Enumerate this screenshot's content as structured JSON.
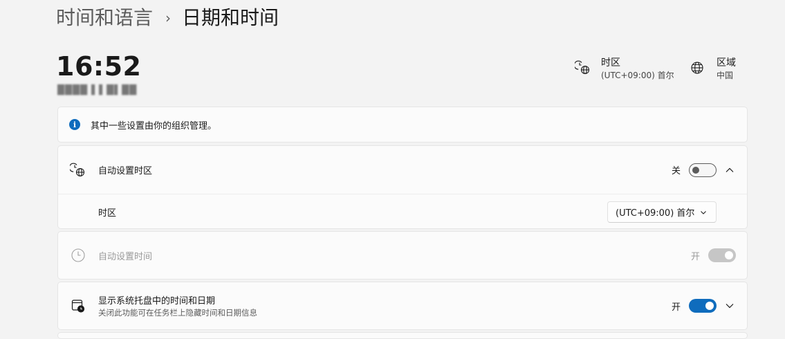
{
  "breadcrumb": {
    "parent": "时间和语言",
    "separator": "›",
    "current": "日期和时间"
  },
  "clock": {
    "time": "16:52",
    "date_obscured": "████ ▌▌█▌██"
  },
  "timezone_info": {
    "title": "时区",
    "value": "(UTC+09:00) 首尔",
    "icon": "clock-globe-icon"
  },
  "region_info": {
    "title": "区域",
    "value": "中国",
    "icon": "globe-icon"
  },
  "banner": {
    "icon_glyph": "i",
    "text": "其中一些设置由你的组织管理。"
  },
  "auto_timezone": {
    "label": "自动设置时区",
    "toggle_text": "关",
    "toggle_state": "off",
    "expanded": true,
    "sub_label": "时区",
    "select_value": "(UTC+09:00) 首尔"
  },
  "auto_time": {
    "label": "自动设置时间",
    "toggle_text": "开",
    "toggle_state": "on",
    "disabled": true
  },
  "tray": {
    "label": "显示系统托盘中的时间和日期",
    "description": "关闭此功能可在任务栏上隐藏时间和日期信息",
    "toggle_text": "开",
    "toggle_state": "on"
  },
  "colors": {
    "accent": "#0f6cbd",
    "background": "#f3f3f3",
    "card": "#fbfbfb"
  }
}
